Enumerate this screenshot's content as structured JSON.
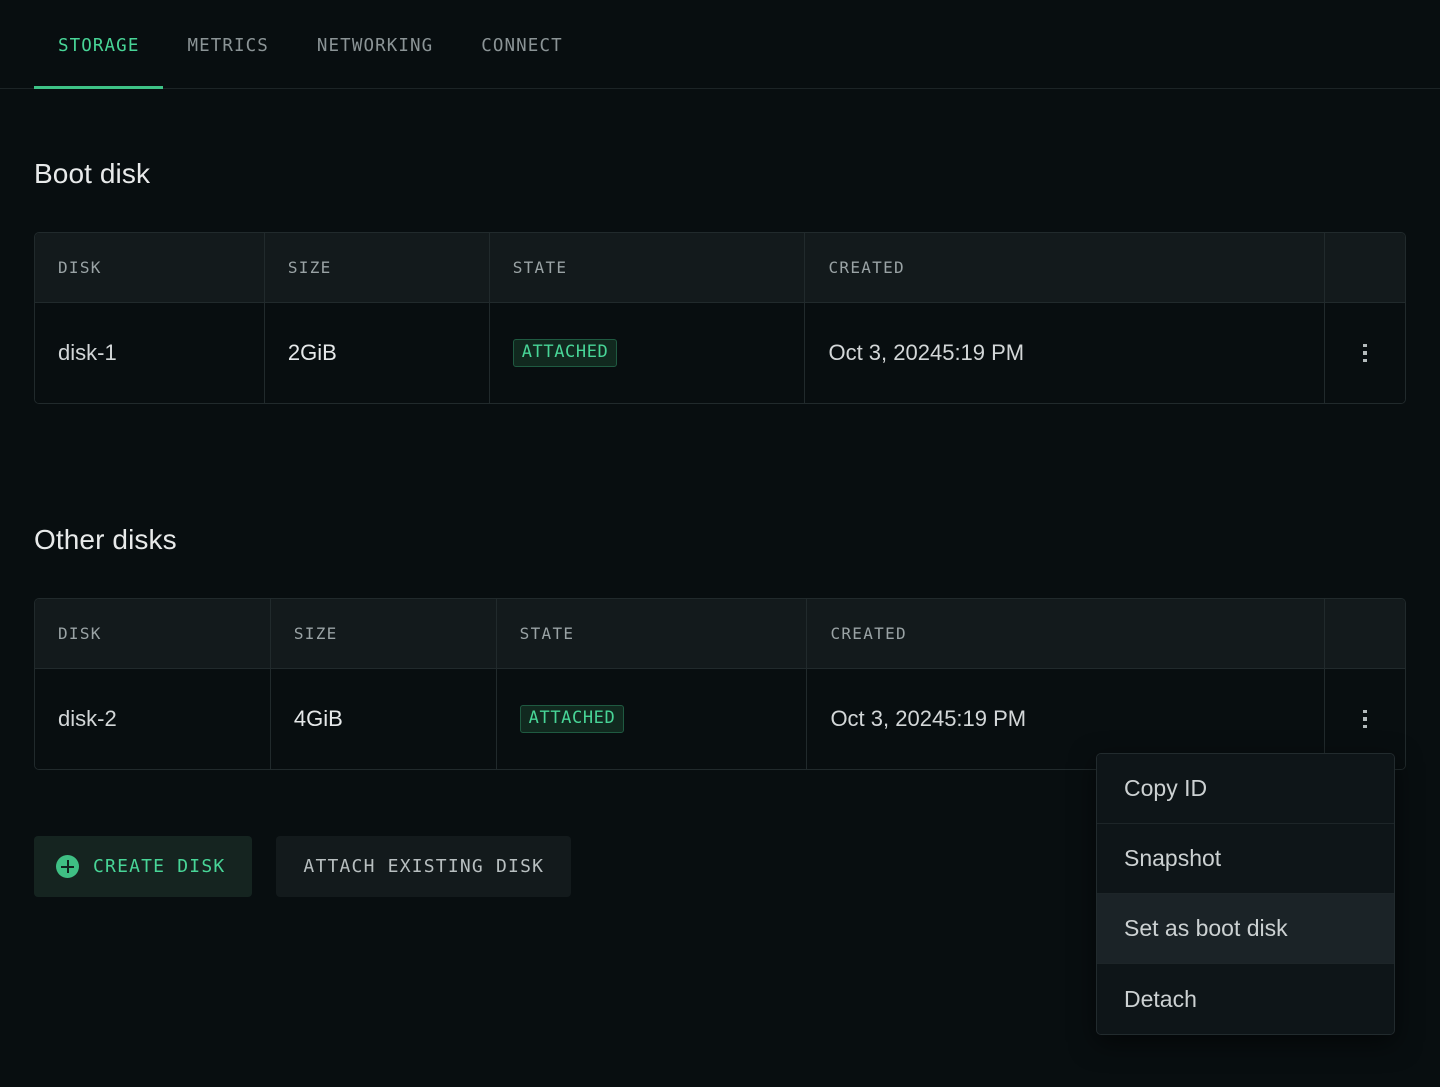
{
  "tabs": [
    {
      "label": "STORAGE",
      "active": true
    },
    {
      "label": "METRICS",
      "active": false
    },
    {
      "label": "NETWORKING",
      "active": false
    },
    {
      "label": "CONNECT",
      "active": false
    }
  ],
  "boot_section": {
    "title": "Boot disk",
    "columns": [
      "DISK",
      "SIZE",
      "STATE",
      "CREATED",
      ""
    ],
    "rows": [
      {
        "disk": "disk-1",
        "size_value": "2",
        "size_unit": "GiB",
        "state": "ATTACHED",
        "created_date": "Oct 3, 2024",
        "created_time": "5:19 PM"
      }
    ]
  },
  "other_section": {
    "title": "Other disks",
    "columns": [
      "DISK",
      "SIZE",
      "STATE",
      "CREATED",
      ""
    ],
    "rows": [
      {
        "disk": "disk-2",
        "size_value": "4",
        "size_unit": "GiB",
        "state": "ATTACHED",
        "created_date": "Oct 3, 2024",
        "created_time": "5:19 PM"
      }
    ]
  },
  "buttons": {
    "create_disk": "CREATE DISK",
    "attach_existing_disk": "ATTACH EXISTING DISK",
    "create_disk_icon": "plus-circle-icon"
  },
  "context_menu": {
    "items": [
      {
        "label": "Copy ID",
        "highlighted": false
      },
      {
        "label": "Snapshot",
        "highlighted": false
      },
      {
        "label": "Set as boot disk",
        "highlighted": true
      },
      {
        "label": "Detach",
        "highlighted": false
      }
    ]
  },
  "icons": {
    "row_actions": "more-vertical-icon"
  },
  "colors": {
    "accent_green": "#48d597",
    "page_background": "#080e10",
    "table_header_background": "#131a1c",
    "border": "#212a2c",
    "badge_text": "#48d597",
    "badge_background": "#11291f",
    "muted_text": "#8b9496"
  }
}
